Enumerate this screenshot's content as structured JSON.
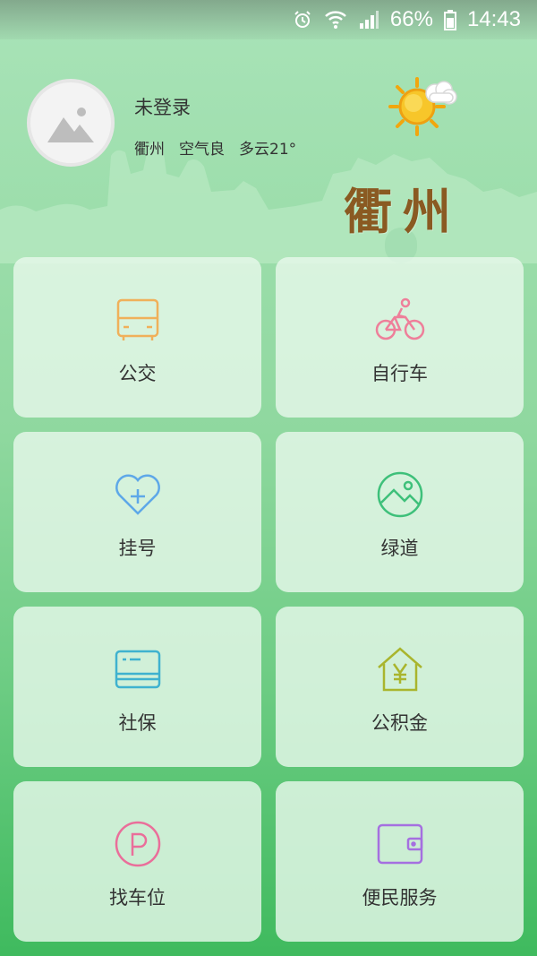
{
  "status_bar": {
    "battery_percent": "66%",
    "time": "14:43"
  },
  "header": {
    "user_name": "未登录",
    "city": "衢州",
    "air_quality": "空气良",
    "weather": "多云21°",
    "city_logo_text": "衢州"
  },
  "services": [
    {
      "label": "公交",
      "icon": "bus-icon",
      "color": "#f0b05a"
    },
    {
      "label": "自行车",
      "icon": "bicycle-icon",
      "color": "#ee7f9a"
    },
    {
      "label": "挂号",
      "icon": "heart-plus-icon",
      "color": "#5ea8e8"
    },
    {
      "label": "绿道",
      "icon": "landscape-icon",
      "color": "#3ec07a"
    },
    {
      "label": "社保",
      "icon": "card-icon",
      "color": "#3fb2cf"
    },
    {
      "label": "公积金",
      "icon": "house-yuan-icon",
      "color": "#a9b52d"
    },
    {
      "label": "找车位",
      "icon": "parking-icon",
      "color": "#ea6e9a"
    },
    {
      "label": "便民服务",
      "icon": "wallet-icon",
      "color": "#a56fe0"
    }
  ]
}
